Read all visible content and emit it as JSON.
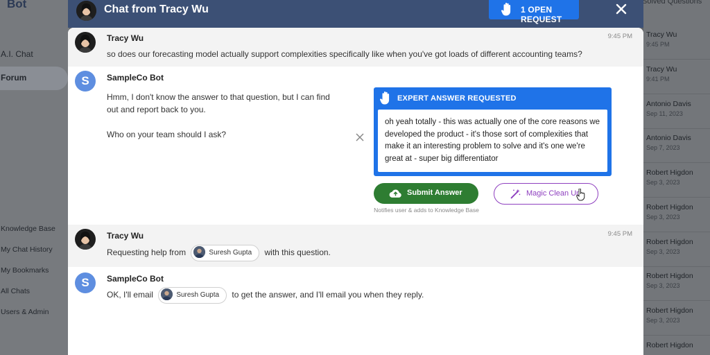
{
  "background": {
    "logo": "Bot",
    "nav": [
      {
        "label": "A.I. Chat"
      },
      {
        "label": "Forum"
      },
      {
        "label": "Knowledge Base"
      },
      {
        "label": "My Chat History"
      },
      {
        "label": "My Bookmarks"
      },
      {
        "label": "All Chats"
      },
      {
        "label": "Users & Admin"
      }
    ],
    "right_heading": "Solved Questions",
    "right_items": [
      {
        "name": "Tracy Wu",
        "date": "9:45 PM"
      },
      {
        "name": "Tracy Wu",
        "date": "9:41 PM"
      },
      {
        "name": "Antonio Davis",
        "date": "Sep 11, 2023"
      },
      {
        "name": "Antonio Davis",
        "date": "Sep 7, 2023"
      },
      {
        "name": "Robert Higdon",
        "date": "Sep 3, 2023"
      },
      {
        "name": "Robert Higdon",
        "date": "Sep 3, 2023"
      },
      {
        "name": "Robert Higdon",
        "date": "Sep 3, 2023"
      },
      {
        "name": "Robert Higdon",
        "date": "Sep 3, 2023"
      },
      {
        "name": "Robert Higdon",
        "date": "Sep 3, 2023"
      },
      {
        "name": "Robert Higdon",
        "date": ""
      }
    ]
  },
  "modal": {
    "title": "Chat from Tracy Wu",
    "open_request_label": "1 OPEN REQUEST",
    "messages": [
      {
        "sender": "Tracy Wu",
        "time": "9:45 PM",
        "text": "so does our forecasting model actually support complexities specifically like when you've got loads of different accounting teams?"
      },
      {
        "sender": "SampleCo Bot",
        "avatar_letter": "S",
        "text_1": "Hmm, I don't know the answer to that question, but I can find out and report back to you.",
        "text_2": "Who on your team should I ask?"
      },
      {
        "sender": "Tracy Wu",
        "time": "9:45 PM",
        "prefix": "Requesting help from",
        "chip": "Suresh Gupta",
        "suffix": "with this question."
      },
      {
        "sender": "SampleCo Bot",
        "avatar_letter": "S",
        "prefix": "OK, I'll email",
        "chip": "Suresh Gupta",
        "suffix": "to get the answer, and I'll email you when they reply."
      }
    ],
    "expert": {
      "heading": "EXPERT ANSWER REQUESTED",
      "answer": "oh yeah totally - this was actually one of the core reasons we developed the product - it's those sort of complexities that make it an interesting problem to solve and it's one we're great at - super big differentiator",
      "submit_label": "Submit Answer",
      "magic_label": "Magic Clean Up",
      "note": "Notifies user & adds to Knowledge Base"
    }
  },
  "colors": {
    "header": "#3c5075",
    "accent": "#1f73e8",
    "submit": "#2e7d32",
    "magic": "#8e3fbf"
  }
}
